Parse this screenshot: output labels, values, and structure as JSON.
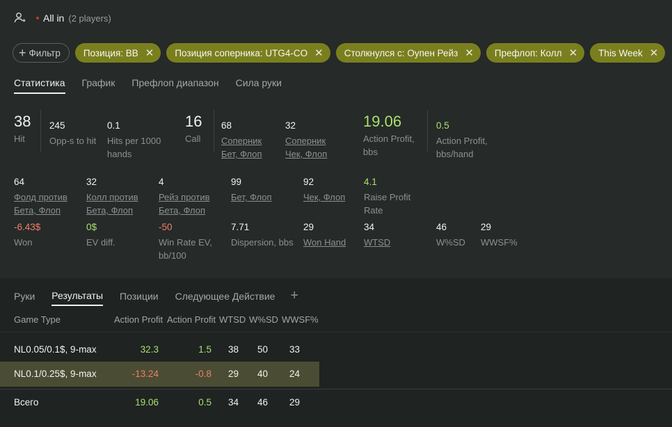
{
  "header": {
    "title": "All in",
    "subtitle": "(2 players)"
  },
  "filters": {
    "add_label": "Фильтр",
    "chips": [
      {
        "label": "Позиция: BB"
      },
      {
        "label": "Позиция соперника: UTG4-CO"
      },
      {
        "label": "Столкнулся с: Оупен Рейз"
      },
      {
        "label": "Префлоп: Колл"
      },
      {
        "label": "This Week"
      }
    ],
    "remove_glyph": "✕"
  },
  "tabs": [
    "Статистика",
    "График",
    "Префлоп диапазон",
    "Сила руки"
  ],
  "stats_row1": [
    {
      "value": "38",
      "label": "Hit"
    },
    {
      "value": "245",
      "label": "Opp-s to hit"
    },
    {
      "value": "0.1",
      "label": "Hits per 1000 hands"
    },
    {
      "value": "16",
      "label": "Call"
    },
    {
      "value": "68",
      "label": "Соперник Бет, Флоп"
    },
    {
      "value": "32",
      "label": "Соперник Чек, Флоп"
    },
    {
      "value": "19.06",
      "label": "Action Profit, bbs"
    },
    {
      "value": "0.5",
      "label": "Action Profit, bbs/hand"
    }
  ],
  "stats_row2": [
    {
      "value": "64",
      "label": "Фолд против Бета, Флоп"
    },
    {
      "value": "32",
      "label": "Колл против Бета, Флоп"
    },
    {
      "value": "4",
      "label": "Рейз против Бета, Флоп"
    },
    {
      "value": "99",
      "label": "Бет, Флоп"
    },
    {
      "value": "92",
      "label": "Чек, Флоп"
    },
    {
      "value": "4.1",
      "label": "Raise Profit Rate"
    }
  ],
  "stats_row3": [
    {
      "value": "-6.43$",
      "label": "Won"
    },
    {
      "value": "0$",
      "label": "EV diff."
    },
    {
      "value": "-50",
      "label": "Win Rate EV, bb/100"
    },
    {
      "value": "7.71",
      "label": "Dispersion, bbs"
    },
    {
      "value": "29",
      "label": "Won Hand"
    },
    {
      "value": "34",
      "label": "WTSD"
    },
    {
      "value": "46",
      "label": "W%SD"
    },
    {
      "value": "29",
      "label": "WWSF%"
    }
  ],
  "bottom_tabs": [
    "Руки",
    "Результаты",
    "Позиции",
    "Следующее Действие"
  ],
  "bottom_add": "+",
  "table": {
    "columns": [
      "Game Type",
      "Action Profit, bbs",
      "Action Profit, bbs/hand",
      "WTSD",
      "W%SD",
      "WWSF%"
    ],
    "rows": [
      {
        "game": "NL0.05/0.1$, 9-max",
        "ap": "32.3",
        "aph": "1.5",
        "wtsd": "38",
        "wsd": "50",
        "wwsf": "33"
      },
      {
        "game": "NL0.1/0.25$, 9-max",
        "ap": "-13.24",
        "aph": "-0.8",
        "wtsd": "29",
        "wsd": "40",
        "wwsf": "24"
      }
    ],
    "total": {
      "game": "Всего",
      "ap": "19.06",
      "aph": "0.5",
      "wtsd": "34",
      "wsd": "46",
      "wwsf": "29"
    }
  },
  "colors": {
    "positive": "#a8e06f",
    "negative": "#f07d6a",
    "chip": "#7a7f1e",
    "selected_row": "#4a4d33"
  }
}
